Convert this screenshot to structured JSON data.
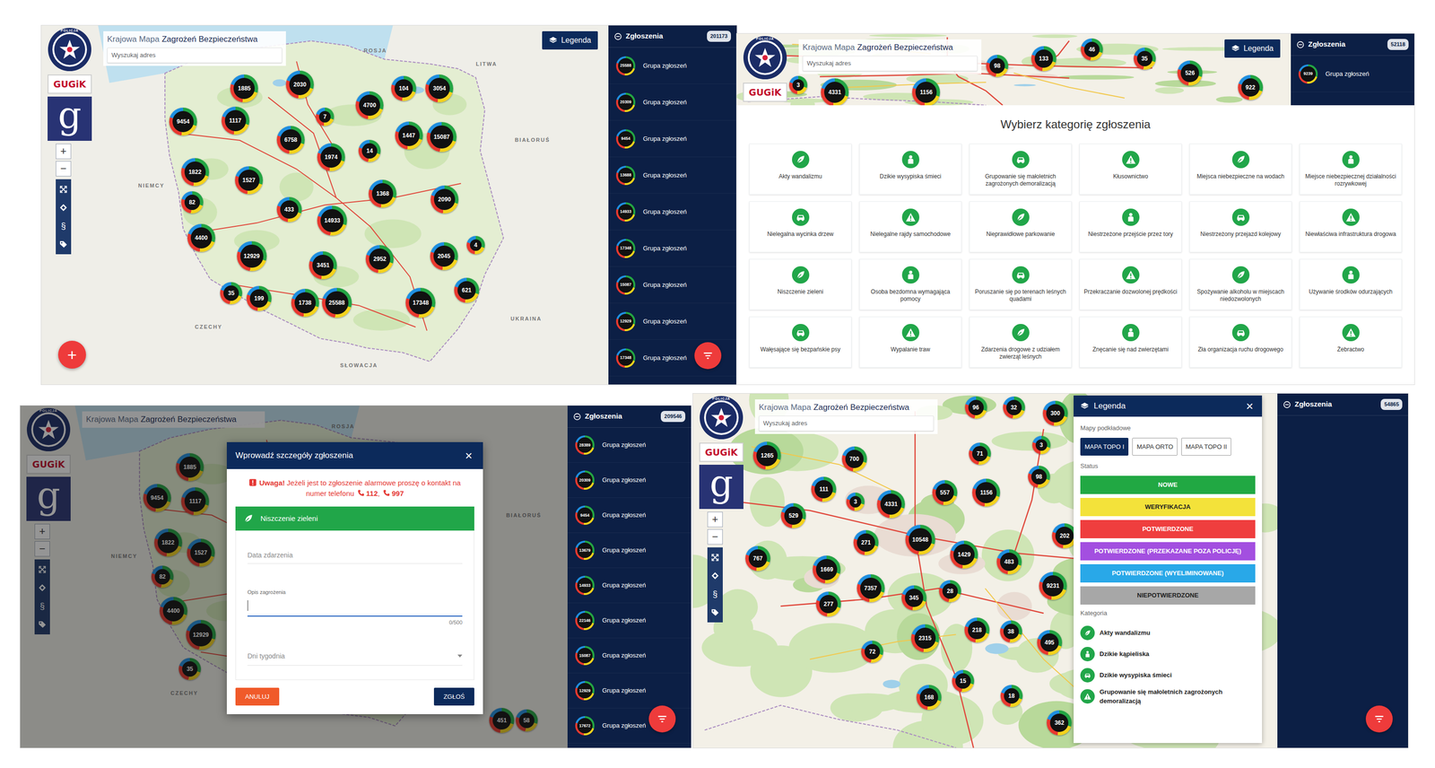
{
  "panels": [
    {
      "kind": "overview",
      "header": {
        "police_label": "POLICJA",
        "gugik": "GUGiK",
        "g_mark": "g",
        "title_light": "Krajowa Mapa",
        "title_bold": "Zagrożeń Bezpieczeństwa",
        "search_placeholder": "Wyszukaj adres",
        "legend_button": "Legenda"
      },
      "controls": {
        "zoom_in": "+",
        "zoom_out": "−",
        "law": "§"
      },
      "country_labels": [
        "ROSJA",
        "LITWA",
        "BIAŁORUŚ",
        "NIEMCY",
        "CZECHY",
        "SŁOWACJA",
        "UKRAINA"
      ],
      "clusters": [
        "1885",
        "2030",
        "104",
        "3054",
        "9454",
        "1117",
        "4700",
        "7",
        "1447",
        "15087",
        "6758",
        "1974",
        "14",
        "1822",
        "1527",
        "1368",
        "2090",
        "82",
        "433",
        "14933",
        "4400",
        "12929",
        "3451",
        "2952",
        "2045",
        "4",
        "35",
        "199",
        "1738",
        "25588",
        "17348",
        "621"
      ],
      "add_button": "+",
      "sidebar": {
        "title": "Zgłoszenia",
        "count": "201173",
        "items": [
          {
            "count": "25588",
            "label": "Grupa zgłoszeń"
          },
          {
            "count": "20309",
            "label": "Grupa zgłoszeń"
          },
          {
            "count": "9454",
            "label": "Grupa zgłoszeń"
          },
          {
            "count": "13688",
            "label": "Grupa zgłoszeń"
          },
          {
            "count": "14933",
            "label": "Grupa zgłoszeń"
          },
          {
            "count": "17348",
            "label": "Grupa zgłoszeń"
          },
          {
            "count": "15087",
            "label": "Grupa zgłoszeń"
          },
          {
            "count": "12929",
            "label": "Grupa zgłoszeń"
          },
          {
            "count": "17348",
            "label": "Grupa zgłoszeń"
          }
        ]
      }
    },
    {
      "kind": "category-picker",
      "header": {
        "police_label": "POLICJA",
        "gugik": "GUGiK",
        "title_light": "Krajowa Mapa",
        "title_bold": "Zagrożeń Bezpieczeństwa",
        "search_placeholder": "Wyszukaj adres",
        "legend_button": "Legenda"
      },
      "clusters": [
        "3",
        "4331",
        "1156",
        "98",
        "133",
        "46",
        "35",
        "526",
        "922"
      ],
      "sidebar": {
        "title": "Zgłoszenia",
        "count": "52118",
        "items": [
          {
            "count": "9239",
            "label": "Grupa zgłoszeń"
          }
        ]
      },
      "picker": {
        "title": "Wybierz kategorię zgłoszenia",
        "categories": [
          "Akty wandalizmu",
          "Dzikie wysypiska śmieci",
          "Grupowanie się małoletnich zagrożonych demoralizacją",
          "Kłusownictwo",
          "Miejsca niebezpieczne na wodach",
          "Miejsce niebezpiecznej działalności rozrywkowej",
          "Nielegalna wycinka drzew",
          "Nielegalne rajdy samochodowe",
          "Nieprawidłowe parkowanie",
          "Niestrzeżone przejście przez tory",
          "Niestrzeżony przejazd kolejowy",
          "Niewłaściwa infrastruktura drogowa",
          "Niszczenie zieleni",
          "Osoba bezdomna wymagająca pomocy",
          "Poruszanie się po terenach leśnych quadami",
          "Przekraczanie dozwolonej prędkości",
          "Spożywanie alkoholu w miejscach niedozwolonych",
          "Używanie środków odurzających",
          "Wałęsające się bezpańskie psy",
          "Wypalanie traw",
          "Zdarzenia drogowe z udziałem zwierząt leśnych",
          "Znęcanie się nad zwierzętami",
          "Zła organizacja ruchu drogowego",
          "Żebractwo"
        ]
      }
    },
    {
      "kind": "report-form",
      "header": {
        "police_label": "POLICJA",
        "gugik": "GUGiK",
        "g_mark": "g",
        "title_light": "Krajowa Mapa",
        "title_bold": "Zagrożeń Bezpieczeństwa"
      },
      "controls": {
        "zoom_in": "+",
        "zoom_out": "−",
        "law": "§"
      },
      "country_labels": [
        "ROSJA",
        "BIAŁORUŚ",
        "NIEMCY",
        "CZECHY"
      ],
      "clusters": [
        "1885",
        "9454",
        "1117",
        "1822",
        "1527",
        "82",
        "4400",
        "12929",
        "35",
        "451",
        "58"
      ],
      "sidebar": {
        "title": "Zgłoszenia",
        "count": "209546",
        "items": [
          {
            "count": "28389",
            "label": "Grupa zgłoszeń"
          },
          {
            "count": "20309",
            "label": "Grupa zgłoszeń"
          },
          {
            "count": "9454",
            "label": "Grupa zgłoszeń"
          },
          {
            "count": "13679",
            "label": "Grupa zgłoszeń"
          },
          {
            "count": "14933",
            "label": "Grupa zgłoszeń"
          },
          {
            "count": "22146",
            "label": "Grupa zgłoszeń"
          },
          {
            "count": "15087",
            "label": "Grupa zgłoszeń"
          },
          {
            "count": "12929",
            "label": "Grupa zgłoszeń"
          },
          {
            "count": "17672",
            "label": "Grupa zgłoszeń"
          }
        ]
      },
      "modal": {
        "title": "Wprowadź szczegóły zgłoszenia",
        "close": "×",
        "warning_lead": "Uwaga!",
        "warning_text": "Jeżeli jest to zgłoszenie alarmowe proszę o kontakt na numer telefonu",
        "phones": [
          "112",
          "997"
        ],
        "phone_separator": ",",
        "category": "Niszczenie zieleni",
        "date_placeholder": "Data zdarzenia",
        "description_label": "Opis zagrożenia",
        "description_counter": "0/500",
        "weekdays_placeholder": "Dni tygodnia",
        "cancel": "ANULUJ",
        "submit": "ZGŁOŚ"
      }
    },
    {
      "kind": "legend",
      "header": {
        "police_label": "POLICJA",
        "gugik": "GUGiK",
        "g_mark": "g",
        "title_light": "Krajowa Mapa",
        "title_bold": "Zagrożeń Bezpieczeństwa",
        "search_placeholder": "Wyszukaj adres"
      },
      "controls": {
        "zoom_in": "+",
        "zoom_out": "−",
        "law": "§"
      },
      "clusters": [
        "96",
        "32",
        "300",
        "1265",
        "700",
        "71",
        "3",
        "98",
        "111",
        "3",
        "4331",
        "557",
        "1156",
        "529",
        "202",
        "271",
        "10548",
        "1429",
        "483",
        "767",
        "9231",
        "1669",
        "7357",
        "345",
        "28",
        "277",
        "218",
        "38",
        "495",
        "72",
        "2315",
        "15",
        "168",
        "18",
        "362"
      ],
      "sidebar": {
        "title": "Zgłoszenia",
        "count": "54865",
        "items": []
      },
      "legend": {
        "title": "Legenda",
        "close": "×",
        "basemaps_title": "Mapy podkładowe",
        "basemaps": [
          {
            "label": "MAPA TOPO I",
            "selected": true
          },
          {
            "label": "MAPA ORTO",
            "selected": false
          },
          {
            "label": "MAPA TOPO II",
            "selected": false
          }
        ],
        "status_title": "Status",
        "statuses": [
          {
            "label": "NOWE",
            "color": "#21a843"
          },
          {
            "label": "WERYFIKACJA",
            "color": "#f3e23a"
          },
          {
            "label": "POTWIERDZONE",
            "color": "#ef3e3e"
          },
          {
            "label": "POTWIERDZONE (PRZEKAZANE POZA POLICJĘ)",
            "color": "#a34fe0"
          },
          {
            "label": "POTWIERDZONE (WYELIMINOWANE)",
            "color": "#29a8e8"
          },
          {
            "label": "NIEPOTWIERDZONE",
            "color": "#a7a7a7"
          }
        ],
        "category_title": "Kategoria",
        "categories": [
          "Akty wandalizmu",
          "Dzikie kąpieliska",
          "Dzikie wysypiska śmieci",
          "Grupowanie się małoletnich zagrożonych demoralizacją"
        ]
      }
    }
  ]
}
